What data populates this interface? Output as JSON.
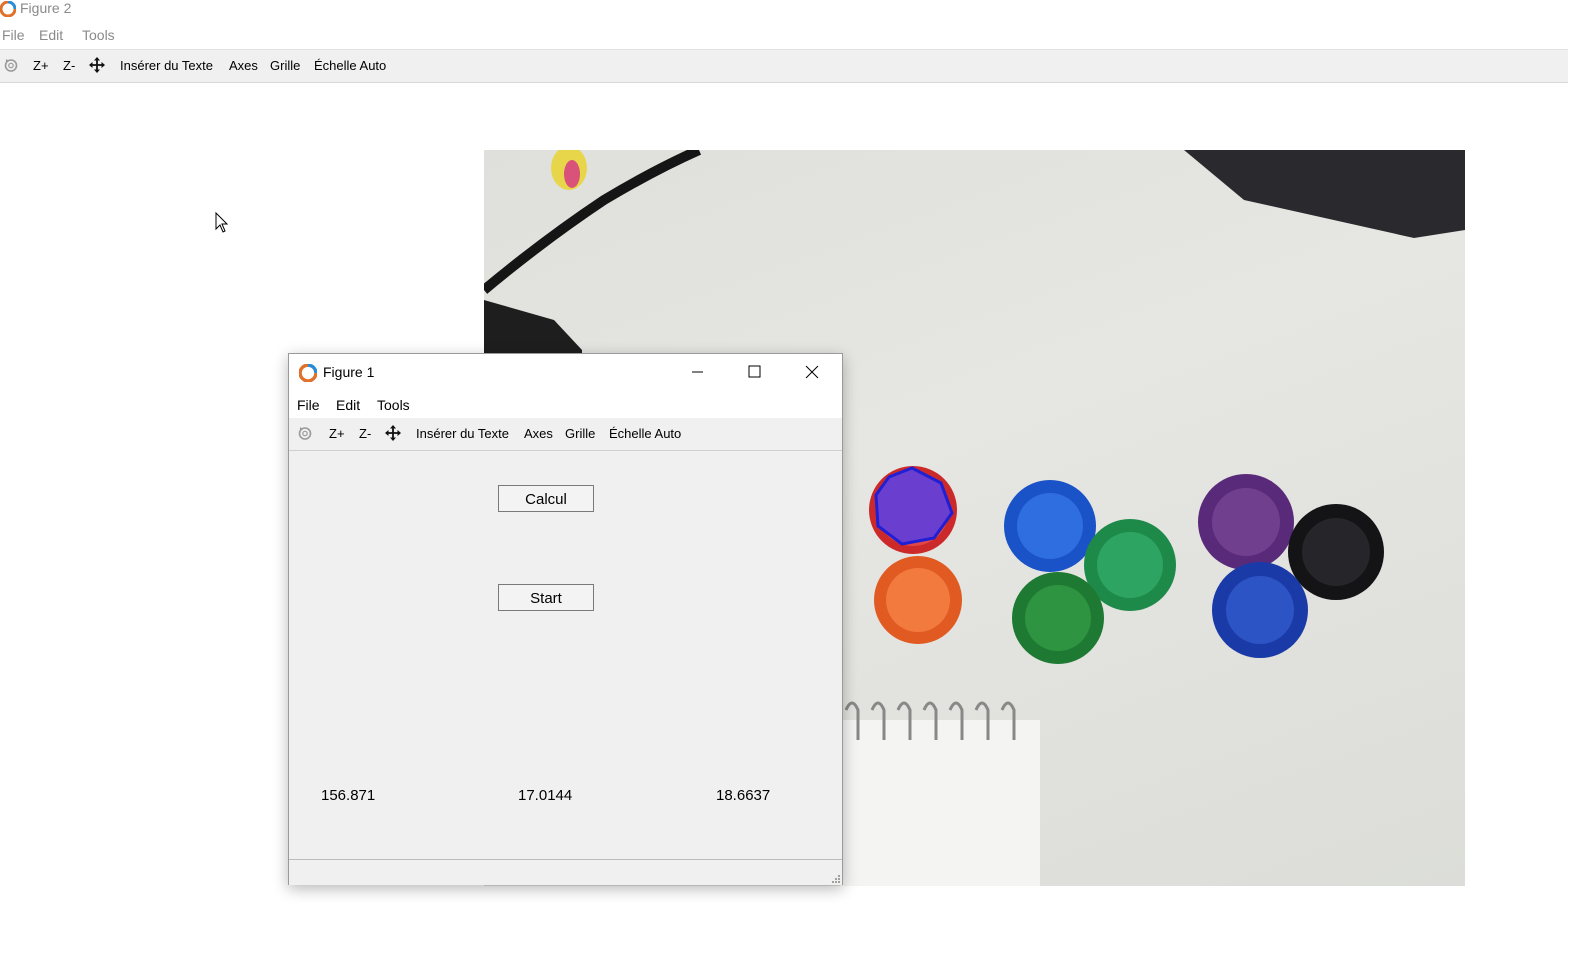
{
  "figure2": {
    "title": "Figure 2",
    "menu": [
      "File",
      "Edit",
      "Tools"
    ],
    "toolbar": {
      "icon": "rotate-icon",
      "zoom_in": "Z+",
      "zoom_out": "Z-",
      "pan_icon": "pan-arrows-icon",
      "insert_text": "Insérer du Texte",
      "axes": "Axes",
      "grid": "Grille",
      "autoscale": "Échelle Auto"
    }
  },
  "figure1": {
    "title": "Figure 1",
    "menu": [
      "File",
      "Edit",
      "Tools"
    ],
    "toolbar": {
      "icon": "rotate-icon",
      "zoom_in": "Z+",
      "zoom_out": "Z-",
      "pan_icon": "pan-arrows-icon",
      "insert_text": "Insérer du Texte",
      "axes": "Axes",
      "grid": "Grille",
      "autoscale": "Échelle Auto"
    },
    "buttons": {
      "calcul": "Calcul",
      "start": "Start"
    },
    "values": [
      "156.871",
      "17.0144",
      "18.6637"
    ]
  },
  "colors": {
    "toolbar_bg": "#f0f0f0",
    "inactive_text": "#8a8a8a",
    "detection_outline": "#1f1fd6",
    "detection_fill": "#6a3fd0"
  }
}
